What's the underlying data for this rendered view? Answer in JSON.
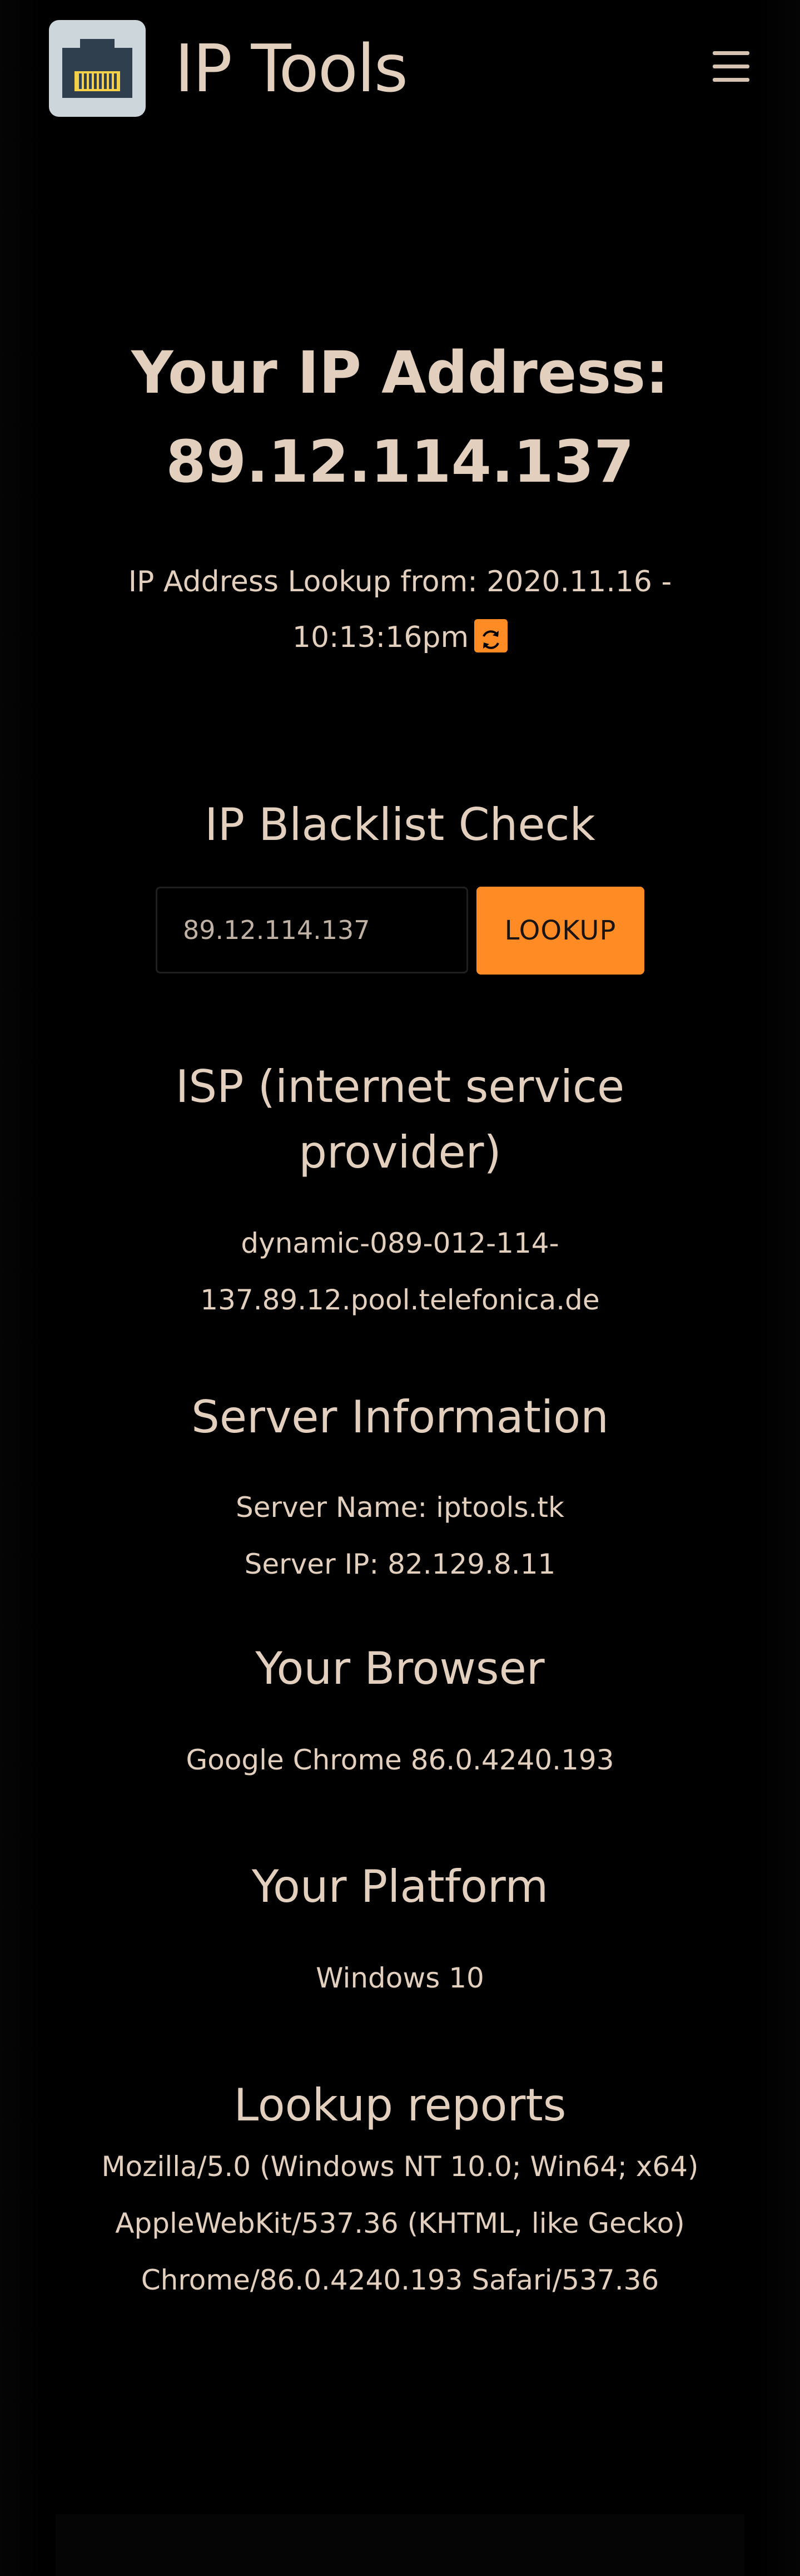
{
  "header": {
    "brand_title": "IP Tools",
    "logo_icon": "ethernet-port-icon",
    "menu_icon": "hamburger-menu-icon"
  },
  "hero": {
    "title_line1": "Your IP Address:",
    "ip_address": "89.12.114.137",
    "lookup_line1": "IP Address Lookup from: 2020.11.16 -",
    "lookup_line2": "10:13:16pm",
    "refresh_icon": "refresh-icon"
  },
  "blacklist": {
    "title": "IP Blacklist Check",
    "input_value": "89.12.114.137",
    "button_label": "LOOKUP"
  },
  "isp": {
    "title_line1": "ISP (internet service",
    "title_line2": "provider)",
    "value_line1": "dynamic-089-012-114-",
    "value_line2": "137.89.12.pool.telefonica.de"
  },
  "server": {
    "title": "Server Information",
    "name": "Server Name: iptools.tk",
    "ip": "Server IP: 82.129.8.11"
  },
  "browser": {
    "title": "Your Browser",
    "value": "Google Chrome 86.0.4240.193"
  },
  "platform": {
    "title": "Your Platform",
    "value": "Windows 10"
  },
  "reports": {
    "title": "Lookup reports",
    "line1": "Mozilla/5.0 (Windows NT 10.0; Win64; x64)",
    "line2": "AppleWebKit/537.36 (KHTML, like Gecko)",
    "line3": "Chrome/86.0.4240.193 Safari/537.36"
  },
  "colors": {
    "background": "#000000",
    "text": "#e3cfbd",
    "accent": "#ff8b24",
    "logo_bg": "#cdd6da"
  }
}
